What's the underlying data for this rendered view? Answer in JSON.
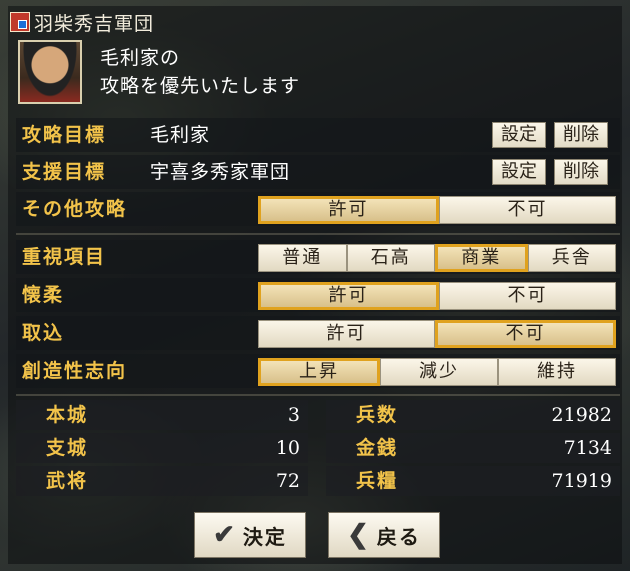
{
  "window": {
    "title": "羽柴秀吉軍団",
    "title_icon": "clan-crest-icon"
  },
  "advisor": {
    "portrait_icon": "samurai-portrait-icon",
    "message_line1": "毛利家の",
    "message_line2": "攻略を優先いたします"
  },
  "targets": {
    "attack": {
      "label": "攻略目標",
      "value": "毛利家",
      "set_label": "設定",
      "delete_label": "削除"
    },
    "support": {
      "label": "支援目標",
      "value": "宇喜多秀家軍団",
      "set_label": "設定",
      "delete_label": "削除"
    }
  },
  "policies": {
    "other_attack": {
      "label": "その他攻略",
      "options": [
        "許可",
        "不可"
      ],
      "selected": "許可"
    },
    "priority": {
      "label": "重視項目",
      "options": [
        "普通",
        "石高",
        "商業",
        "兵舎"
      ],
      "selected": "商業"
    },
    "appease": {
      "label": "懐柔",
      "options": [
        "許可",
        "不可"
      ],
      "selected": "許可"
    },
    "recruit": {
      "label": "取込",
      "options": [
        "許可",
        "不可"
      ],
      "selected": "不可"
    },
    "creativity": {
      "label": "創造性志向",
      "options": [
        "上昇",
        "減少",
        "維持"
      ],
      "selected": "上昇"
    }
  },
  "stats": {
    "main_castle": {
      "label": "本城",
      "value": "3"
    },
    "branch_castle": {
      "label": "支城",
      "value": "10"
    },
    "generals": {
      "label": "武将",
      "value": "72"
    },
    "soldiers": {
      "label": "兵数",
      "value": "21982"
    },
    "gold": {
      "label": "金銭",
      "value": "7134"
    },
    "provisions": {
      "label": "兵糧",
      "value": "71919"
    }
  },
  "actions": {
    "confirm_label": "決定",
    "confirm_icon": "checkmark-icon",
    "back_label": "戻る",
    "back_icon": "chevron-left-icon"
  },
  "colors": {
    "label_gold": "#f2c34a",
    "selected_border": "#e0a21e",
    "button_face": "#fbf6e9"
  }
}
